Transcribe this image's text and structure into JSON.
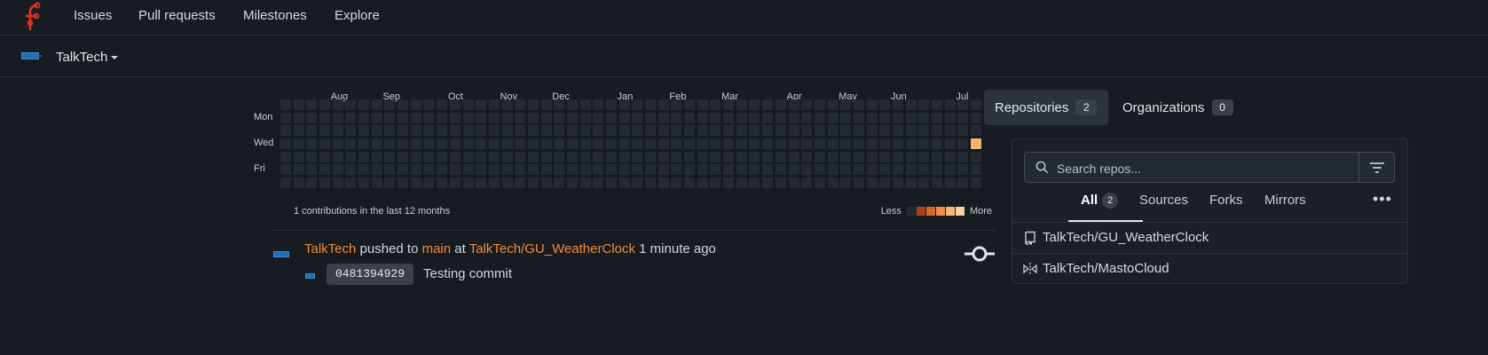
{
  "nav": {
    "items": [
      {
        "label": "Issues"
      },
      {
        "label": "Pull requests"
      },
      {
        "label": "Milestones"
      },
      {
        "label": "Explore"
      }
    ]
  },
  "context": {
    "org_name": "TalkTech"
  },
  "heatmap": {
    "months": [
      "Aug",
      "Sep",
      "Oct",
      "Nov",
      "Dec",
      "Jan",
      "Feb",
      "Mar",
      "Apr",
      "May",
      "Jun",
      "Jul"
    ],
    "days": [
      "Mon",
      "Wed",
      "Fri"
    ],
    "summary": "1 contributions in the last 12 months",
    "legend_less": "Less",
    "legend_more": "More",
    "legend_colors": [
      "#232a33",
      "#a3421b",
      "#d66a2a",
      "#ee8f45",
      "#f5b575",
      "#f9d2a4"
    ],
    "active_contribution_week": 53,
    "active_contribution_day": 3
  },
  "feed": {
    "actor": "TalkTech",
    "action": "pushed to",
    "branch": "main",
    "preposition": "at",
    "repo": "TalkTech/GU_WeatherClock",
    "time": "1 minute ago",
    "commit_sha": "0481394929",
    "commit_message": "Testing commit"
  },
  "sidebar": {
    "tabs": [
      {
        "label": "Repositories",
        "count": "2"
      },
      {
        "label": "Organizations",
        "count": "0"
      }
    ],
    "search_placeholder": "Search repos...",
    "filters": [
      {
        "label": "All",
        "count": "2"
      },
      {
        "label": "Sources"
      },
      {
        "label": "Forks"
      },
      {
        "label": "Mirrors"
      }
    ],
    "more": "•••",
    "repos": [
      {
        "name": "TalkTech/GU_WeatherClock",
        "icon": "repo-icon"
      },
      {
        "name": "TalkTech/MastoCloud",
        "icon": "mirror-icon"
      }
    ]
  },
  "colors": {
    "accent": "#f08a3a",
    "background": "#171c22"
  }
}
